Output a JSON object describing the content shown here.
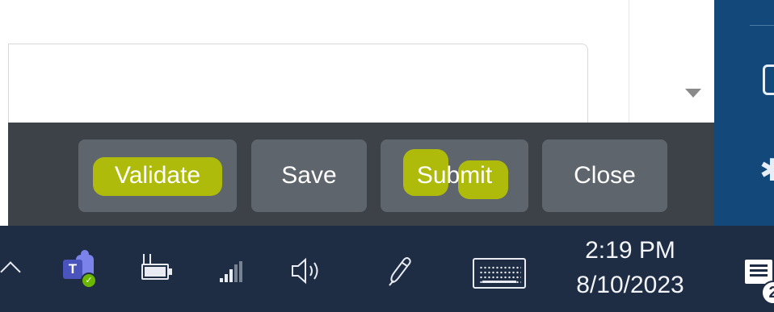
{
  "form": {
    "field_value": ""
  },
  "actions": {
    "validate_label": "Validate",
    "save_label": "Save",
    "submit_label": "Submit",
    "close_label": "Close"
  },
  "highlight_color": "#b8c400",
  "icons": {
    "dropdown": "chevron-down-icon",
    "side_panel": [
      "square-icon",
      "puzzle-icon"
    ],
    "taskbar": [
      "chevron-up-icon",
      "teams-icon",
      "battery-charging-icon",
      "signal-icon",
      "volume-icon",
      "pen-icon",
      "touch-keyboard-icon",
      "notification-icon"
    ]
  },
  "taskbar": {
    "time": "2:19 PM",
    "date": "8/10/2023",
    "notification_badge": "2"
  },
  "colors": {
    "button_bar": "#3d4248",
    "button": "#5f656c",
    "side_panel": "#12497a",
    "taskbar": "#1e2d44"
  }
}
